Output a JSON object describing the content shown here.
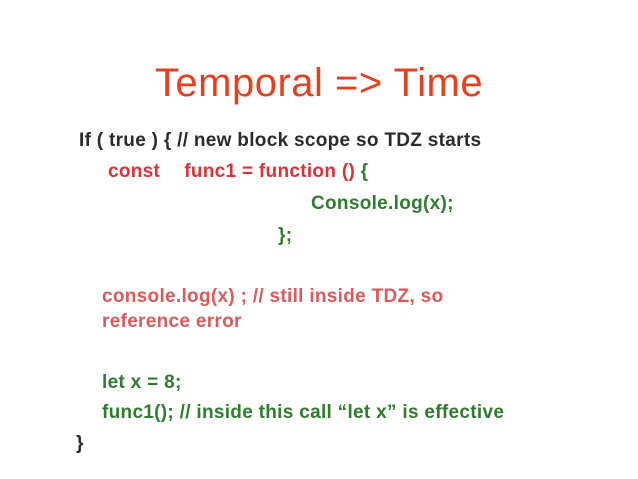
{
  "slide": {
    "title": "Temporal => Time",
    "code": {
      "if_line": "If ( true ) { // new block scope so TDZ starts",
      "const_keyword": "const",
      "const_rest_red": "func1 = function () ",
      "const_rest_green": "{",
      "console_log_line": "Console.log(x);",
      "close_func": "};",
      "ref_line_1": "console.log(x) ; // still inside TDZ, so",
      "ref_line_2": "reference error",
      "let_line": "let x = 8;",
      "call_line": "func1(); // inside this call “let x” is effective",
      "close_block": "}"
    }
  },
  "colors": {
    "title": "#e8401f",
    "dark_text": "#2b2b2b",
    "red_code": "#e0303a",
    "green_code": "#2e7d2e",
    "salmon_code": "#dc5a5a"
  }
}
